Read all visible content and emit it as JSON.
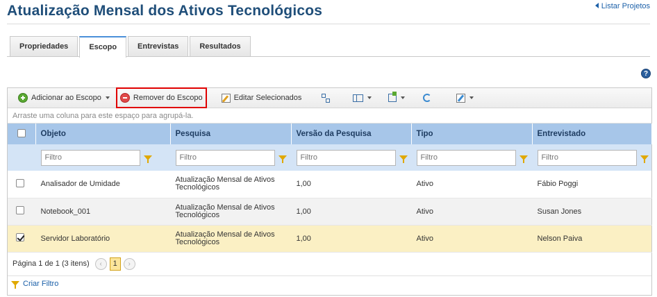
{
  "page": {
    "title": "Atualização Mensal dos Ativos Tecnológicos",
    "back_link": "Listar Projetos"
  },
  "tabs": [
    {
      "label": "Propriedades",
      "active": false
    },
    {
      "label": "Escopo",
      "active": true
    },
    {
      "label": "Entrevistas",
      "active": false
    },
    {
      "label": "Resultados",
      "active": false
    }
  ],
  "help": {
    "symbol": "?"
  },
  "toolbar": {
    "add_label": "Adicionar ao Escopo",
    "remove_label": "Remover do Escopo",
    "edit_label": "Editar Selecionados"
  },
  "grid": {
    "group_hint": "Arraste uma coluna para este espaço para agrupá-la.",
    "columns": [
      "Objeto",
      "Pesquisa",
      "Versão da Pesquisa",
      "Tipo",
      "Entrevistado"
    ],
    "filter_placeholder": "Filtro",
    "rows": [
      {
        "objeto": "Analisador de Umidade",
        "pesquisa": "Atualização Mensal de Ativos Tecnológicos",
        "versao": "1,00",
        "tipo": "Ativo",
        "entrevistado": "Fábio Poggi",
        "checked": false
      },
      {
        "objeto": "Notebook_001",
        "pesquisa": "Atualização Mensal de Ativos Tecnológicos",
        "versao": "1,00",
        "tipo": "Ativo",
        "entrevistado": "Susan Jones",
        "checked": false
      },
      {
        "objeto": "Servidor Laboratório",
        "pesquisa": "Atualização Mensal de Ativos Tecnológicos",
        "versao": "1,00",
        "tipo": "Ativo",
        "entrevistado": "Nelson Paiva",
        "checked": true
      }
    ],
    "pager": {
      "summary": "Página 1 de 1 (3 itens)",
      "current_page": "1"
    },
    "create_filter": "Criar Filtro"
  },
  "colors": {
    "header": "#a7c6e9",
    "filter_row": "#d4e4f6",
    "selected_row": "#fbf0c4",
    "highlight": "#e00000"
  }
}
